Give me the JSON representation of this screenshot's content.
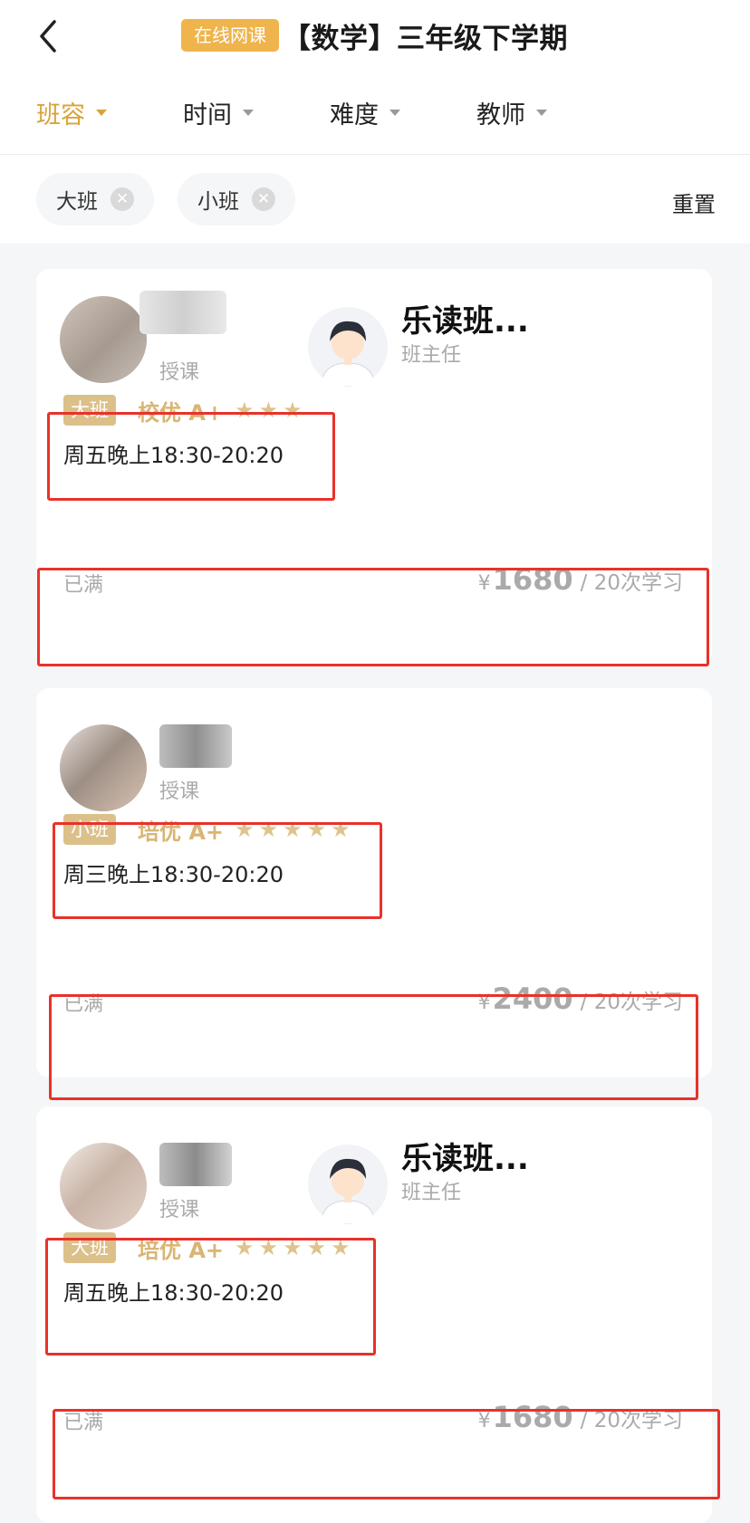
{
  "header": {
    "badge": "在线网课",
    "title": "【数学】三年级下学期"
  },
  "filters": [
    {
      "label": "班容",
      "active": true
    },
    {
      "label": "时间",
      "active": false
    },
    {
      "label": "难度",
      "active": false
    },
    {
      "label": "教师",
      "active": false
    }
  ],
  "tags": [
    {
      "label": "大班",
      "remove_icon": "close-icon"
    },
    {
      "label": "小班",
      "remove_icon": "close-icon"
    }
  ],
  "reset_label": "重置",
  "courses": [
    {
      "teacher_role": "授课",
      "manager_name": "乐读班...",
      "manager_role": "班主任",
      "class_size": "大班",
      "grade": "校优 A+",
      "stars": "★★★",
      "star_count": 3,
      "schedule": "周五晚上18:30-20:20",
      "status": "已满",
      "currency": "¥",
      "price": "1680",
      "per": "/ 20次学习"
    },
    {
      "teacher_role": "授课",
      "class_size": "小班",
      "grade": "培优 A+",
      "stars": "★★★★★",
      "star_count": 5,
      "schedule": "周三晚上18:30-20:20",
      "status": "已满",
      "currency": "¥",
      "price": "2400",
      "per": "/ 20次学习"
    },
    {
      "teacher_role": "授课",
      "manager_name": "乐读班...",
      "manager_role": "班主任",
      "class_size": "大班",
      "grade": "培优 A+",
      "stars": "★★★★★",
      "star_count": 5,
      "schedule": "周五晚上18:30-20:20",
      "status": "已满",
      "currency": "¥",
      "price": "1680",
      "per": "/ 20次学习"
    }
  ],
  "colors": {
    "accent": "#d9a33a",
    "badge": "#f0b44c",
    "highlight_box": "#e8322a"
  }
}
